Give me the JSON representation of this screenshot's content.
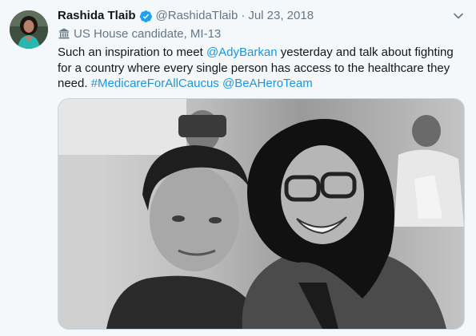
{
  "tweet": {
    "author_name": "Rashida Tlaib",
    "author_handle": "@RashidaTlaib",
    "separator": "·",
    "date": "Jul 23, 2018",
    "label_text": "US House candidate, MI-13",
    "text": {
      "part1": "Such an inspiration to meet ",
      "mention1": "@AdyBarkan",
      "part2": " yesterday and talk about fighting for a country where every single person has access to the healthcare they need. ",
      "hashtag1": "#MedicareForAllCaucus",
      "part3": " ",
      "mention2": "@BeAHeroTeam"
    }
  },
  "icons": {
    "verified": "verified-badge-icon",
    "label": "government-building-icon",
    "menu": "chevron-down-icon"
  },
  "colors": {
    "link": "#1b95e0",
    "verified": "#1da1f2",
    "secondary_text": "#657786",
    "background": "#f5f8fa"
  }
}
